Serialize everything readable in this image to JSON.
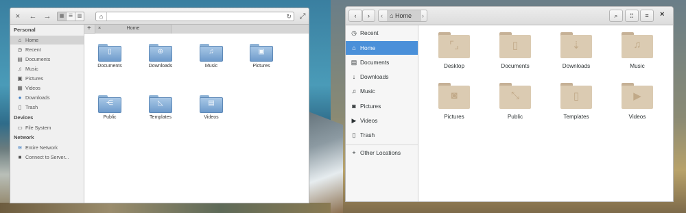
{
  "left_window": {
    "toolbar": {
      "close": "×",
      "back": "←",
      "forward": "→",
      "view_icons": "▦",
      "view_list": "☰",
      "view_columns": "▥",
      "reload": "↻",
      "fullscreen": "⤢"
    },
    "sidebar": {
      "sections": [
        {
          "heading": "Personal",
          "items": [
            {
              "label": "Home",
              "icon": "home-icon",
              "active": true
            },
            {
              "label": "Recent",
              "icon": "clock-icon"
            },
            {
              "label": "Documents",
              "icon": "document-icon"
            },
            {
              "label": "Music",
              "icon": "music-icon"
            },
            {
              "label": "Pictures",
              "icon": "picture-icon"
            },
            {
              "label": "Videos",
              "icon": "video-icon"
            },
            {
              "label": "Downloads",
              "icon": "download-icon"
            },
            {
              "label": "Trash",
              "icon": "trash-icon"
            }
          ]
        },
        {
          "heading": "Devices",
          "items": [
            {
              "label": "File System",
              "icon": "drive-icon"
            }
          ]
        },
        {
          "heading": "Network",
          "items": [
            {
              "label": "Entire Network",
              "icon": "network-icon"
            },
            {
              "label": "Connect to Server...",
              "icon": "server-icon"
            }
          ]
        }
      ]
    },
    "tabs": {
      "new_tab": "+",
      "close": "×",
      "active_tab": "Home"
    },
    "folders": [
      "Documents",
      "Downloads",
      "Music",
      "Pictures",
      "Public",
      "Templates",
      "Videos"
    ],
    "colors": {
      "folder": "#7fa6d2",
      "sidebar_bg": "#f0f0f0"
    }
  },
  "right_window": {
    "toolbar": {
      "back": "‹",
      "forward": "›",
      "path_left": "‹",
      "path_label": "Home",
      "path_right": "›",
      "search": "⌕",
      "view": "⁞⁞",
      "menu": "≡",
      "close": "×"
    },
    "sidebar": {
      "items": [
        {
          "label": "Recent",
          "icon": "clock-icon"
        },
        {
          "label": "Home",
          "icon": "home-icon",
          "active": true
        },
        {
          "label": "Documents",
          "icon": "document-icon"
        },
        {
          "label": "Downloads",
          "icon": "download-icon"
        },
        {
          "label": "Music",
          "icon": "music-icon"
        },
        {
          "label": "Pictures",
          "icon": "camera-icon"
        },
        {
          "label": "Videos",
          "icon": "video-icon"
        },
        {
          "label": "Trash",
          "icon": "trash-icon"
        },
        {
          "label": "Other Locations",
          "icon": "plus-icon"
        }
      ]
    },
    "folders": [
      "Desktop",
      "Documents",
      "Downloads",
      "Music",
      "Pictures",
      "Public",
      "Templates",
      "Videos"
    ],
    "colors": {
      "folder": "#dbcbb2",
      "accent": "#4a90d9"
    }
  }
}
